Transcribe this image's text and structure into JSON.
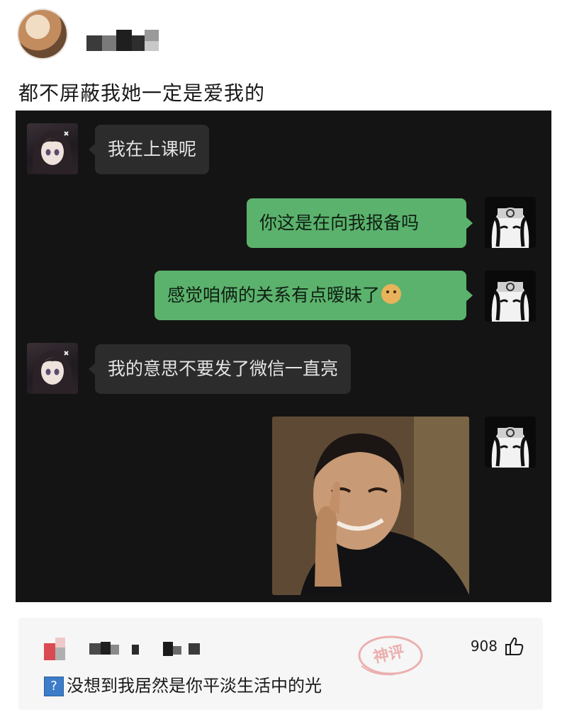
{
  "post": {
    "caption": "都不屏蔽我她一定是爱我的"
  },
  "chat": {
    "messages": [
      {
        "side": "left",
        "text": "我在上课呢"
      },
      {
        "side": "right",
        "text": "你这是在向我报备吗"
      },
      {
        "side": "right",
        "text": "感觉咱俩的关系有点暧昧了",
        "emoji": "doge-emoji"
      },
      {
        "side": "left",
        "text": "我的意思不要发了微信一直亮"
      },
      {
        "side": "right",
        "type": "image",
        "image": "meme-photo"
      }
    ]
  },
  "comment": {
    "like_count": "908",
    "badge": "神评",
    "text": "没想到我居然是你平淡生活中的光",
    "prefix_icon": "question-mark-icon"
  },
  "colors": {
    "chat_bg": "#141414",
    "bubble_left": "#2c2c2c",
    "bubble_right": "#5bb26d",
    "comment_bg": "#f6f6f6"
  }
}
